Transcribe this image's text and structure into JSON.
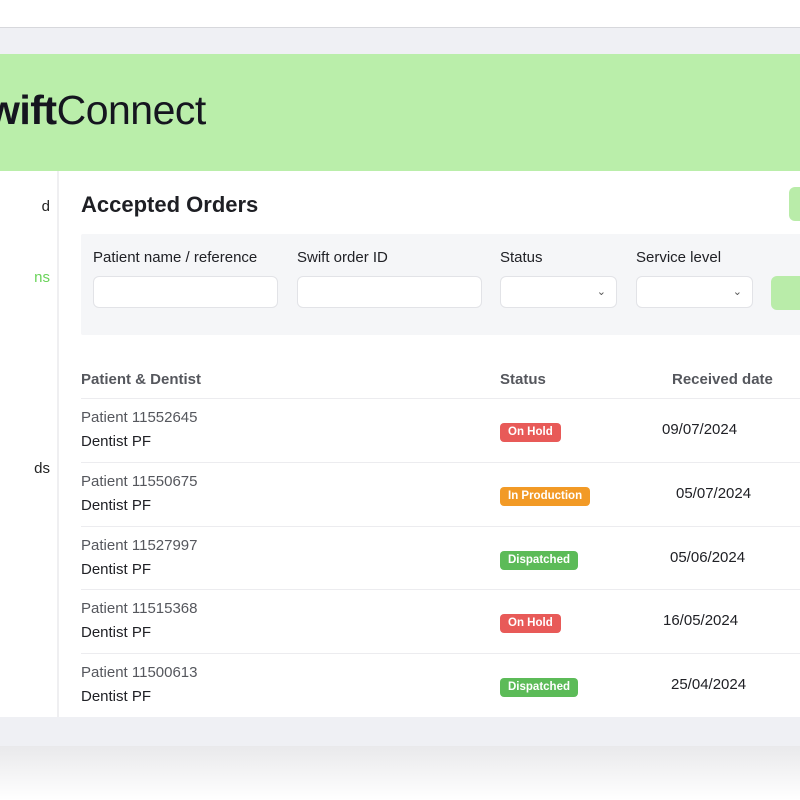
{
  "app": {
    "logo_bold": "wift",
    "logo_regular": "Connect"
  },
  "sidebar": {
    "items": [
      {
        "label": "d",
        "active": false
      },
      {
        "label": "ns",
        "active": true
      },
      {
        "label": "ds",
        "active": false
      }
    ]
  },
  "page": {
    "title": "Accepted Orders"
  },
  "filters": {
    "patient_label": "Patient name / reference",
    "patient_value": "",
    "order_id_label": "Swift order ID",
    "order_id_value": "",
    "status_label": "Status",
    "status_value": "",
    "service_level_label": "Service level",
    "service_level_value": "",
    "chevron_glyph": "⌄"
  },
  "table": {
    "headers": {
      "patient_dentist": "Patient & Dentist",
      "status": "Status",
      "received_date": "Received date"
    },
    "rows": [
      {
        "patient": "Patient 11552645",
        "dentist": "Dentist PF",
        "status": "On Hold",
        "status_color": "#e85a58",
        "date": "09/07/2024"
      },
      {
        "patient": "Patient 11550675",
        "dentist": "Dentist PF",
        "status": "In Production",
        "status_color": "#f29a26",
        "date": "05/07/2024"
      },
      {
        "patient": "Patient 11527997",
        "dentist": "Dentist PF",
        "status": "Dispatched",
        "status_color": "#5cbb58",
        "date": "05/06/2024"
      },
      {
        "patient": "Patient 11515368",
        "dentist": "Dentist PF",
        "status": "On Hold",
        "status_color": "#e85a58",
        "date": "16/05/2024"
      },
      {
        "patient": "Patient 11500613",
        "dentist": "Dentist PF",
        "status": "Dispatched",
        "status_color": "#5cbb58",
        "date": "25/04/2024"
      }
    ]
  },
  "colors": {
    "brand_green": "#baeeaa",
    "accent_green": "#6ad35a",
    "button_green": "#b9eca9"
  }
}
